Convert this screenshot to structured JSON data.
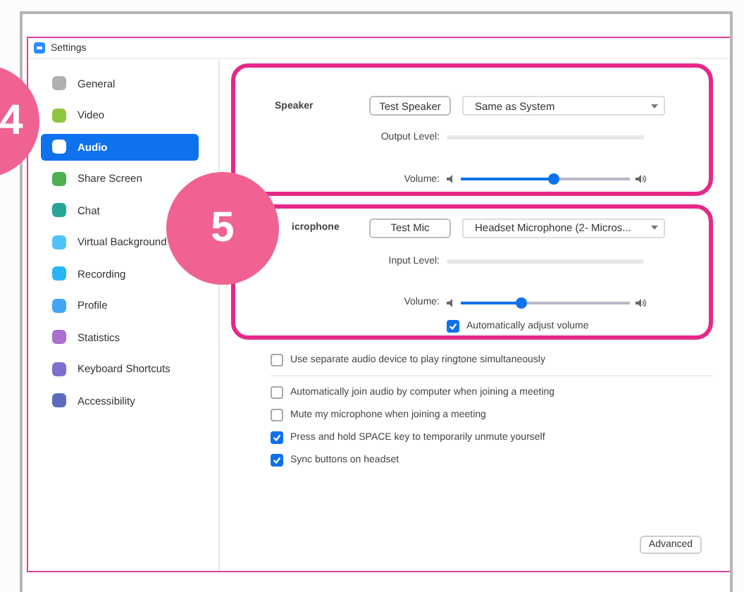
{
  "window": {
    "title": "Settings"
  },
  "sidebar": {
    "items": [
      {
        "label": "General",
        "color": "#b0b0b0",
        "selected": false
      },
      {
        "label": "Video",
        "color": "#8cc63f",
        "selected": false
      },
      {
        "label": "Audio",
        "color": "#ffffff",
        "selected": true
      },
      {
        "label": "Share Screen",
        "color": "#4caf50",
        "selected": false
      },
      {
        "label": "Chat",
        "color": "#26a69a",
        "selected": false
      },
      {
        "label": "Virtual Background",
        "color": "#4fc3f7",
        "selected": false
      },
      {
        "label": "Recording",
        "color": "#29b6f6",
        "selected": false
      },
      {
        "label": "Profile",
        "color": "#42a5f5",
        "selected": false
      },
      {
        "label": "Statistics",
        "color": "#ab6fd0",
        "selected": false
      },
      {
        "label": "Keyboard Shortcuts",
        "color": "#7e6fd0",
        "selected": false
      },
      {
        "label": "Accessibility",
        "color": "#5c6bc0",
        "selected": false
      }
    ]
  },
  "speaker": {
    "label": "Speaker",
    "test_button": "Test Speaker",
    "device": "Same as System",
    "level_label": "Output Level:",
    "volume_label": "Volume:",
    "volume": {
      "level": 0.55
    }
  },
  "microphone": {
    "label": "icrophone",
    "test_button": "Test Mic",
    "device": "Headset Microphone (2- Micros...",
    "level_label": "Input Level:",
    "volume_label": "Volume:",
    "volume": {
      "level": 0.36
    },
    "auto_adjust": {
      "label": "Automatically adjust volume",
      "checked": true
    }
  },
  "options": [
    {
      "label": "Use separate audio device to play ringtone simultaneously",
      "checked": false
    },
    {
      "label": "Automatically join audio by computer when joining a meeting",
      "checked": false
    },
    {
      "label": "Mute my microphone when joining a meeting",
      "checked": false
    },
    {
      "label": "Press and hold SPACE key to temporarily unmute yourself",
      "checked": true
    },
    {
      "label": "Sync buttons on headset",
      "checked": true
    }
  ],
  "advanced_button": "Advanced",
  "callouts": [
    "4",
    "5"
  ]
}
